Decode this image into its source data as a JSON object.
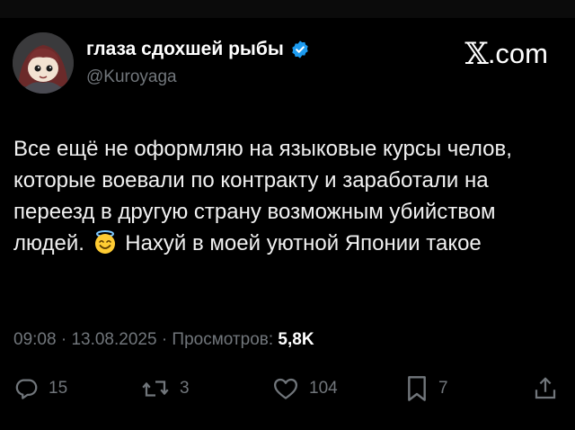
{
  "author": {
    "display_name": "глаза сдохшей рыбы",
    "handle": "@Kuroyaga",
    "verified_icon": "verified-badge-icon",
    "verified_color": "#1d9bf0"
  },
  "site": {
    "logo_letter": "𝕏",
    "logo_suffix": ".com"
  },
  "tweet": {
    "text_before_emoji": "Все ещё не оформляю на языковые курсы челов, которые воевали по контракту и заработали на переезд в другую страну возможным убийством людей.",
    "emoji": "smiling-face-with-halo-icon",
    "text_after_emoji": "Нахуй в моей уютной Японии такое"
  },
  "meta": {
    "time": "09:08",
    "separator": "·",
    "date": "13.08.2025",
    "views_label": "Просмотров:",
    "views_count": "5,8K"
  },
  "actions": {
    "replies": "15",
    "reposts": "3",
    "likes": "104",
    "bookmarks": "7"
  },
  "colors": {
    "background": "#000000",
    "text": "#e7e9ea",
    "secondary": "#71767b"
  }
}
